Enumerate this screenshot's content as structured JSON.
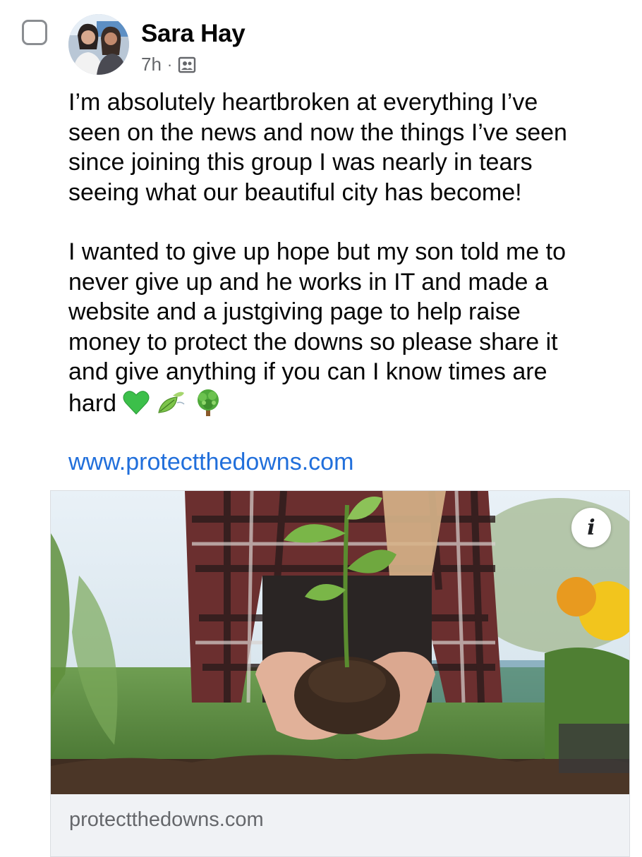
{
  "post": {
    "author_name": "Sara Hay",
    "time": "7h",
    "separator": "·",
    "audience_icon": "group-icon",
    "paragraph_1": "I’m absolutely heartbroken at everything I’ve\nseen on the news and now the things I’ve seen\nsince joining this group I was nearly in tears\nseeing what our beautiful city has become!",
    "paragraph_2": "I wanted to give up hope but my son told me to\nnever give up and he works in IT and made a\nwebsite and a justgiving page to help raise\nmoney to protect the downs so please share it\nand give anything if you can I know times are\nhard",
    "emojis": [
      "green-heart",
      "leaf-fluttering-in-wind",
      "deciduous-tree"
    ],
    "link_text": "www.protectthedowns.com"
  },
  "link_preview": {
    "image": "hands-holding-seedling-in-soil",
    "info_label": "i",
    "domain": "protectthedowns.com"
  },
  "colors": {
    "link": "#216fdb",
    "secondary_text": "#65676b",
    "card_footer": "#f0f2f5"
  }
}
